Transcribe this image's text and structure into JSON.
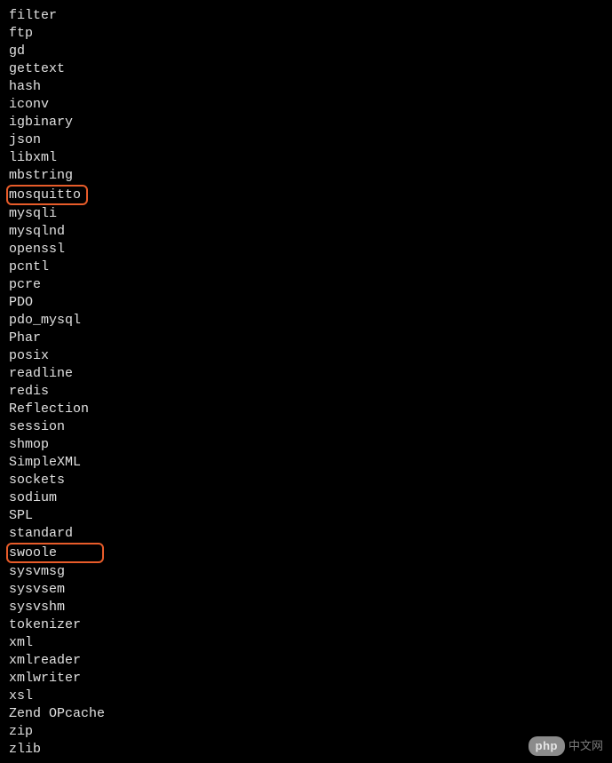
{
  "modules": [
    {
      "name": "filter",
      "highlighted": false
    },
    {
      "name": "ftp",
      "highlighted": false
    },
    {
      "name": "gd",
      "highlighted": false
    },
    {
      "name": "gettext",
      "highlighted": false
    },
    {
      "name": "hash",
      "highlighted": false
    },
    {
      "name": "iconv",
      "highlighted": false
    },
    {
      "name": "igbinary",
      "highlighted": false
    },
    {
      "name": "json",
      "highlighted": false
    },
    {
      "name": "libxml",
      "highlighted": false
    },
    {
      "name": "mbstring",
      "highlighted": false
    },
    {
      "name": "mosquitto",
      "highlighted": true
    },
    {
      "name": "mysqli",
      "highlighted": false
    },
    {
      "name": "mysqlnd",
      "highlighted": false
    },
    {
      "name": "openssl",
      "highlighted": false
    },
    {
      "name": "pcntl",
      "highlighted": false
    },
    {
      "name": "pcre",
      "highlighted": false
    },
    {
      "name": "PDO",
      "highlighted": false
    },
    {
      "name": "pdo_mysql",
      "highlighted": false
    },
    {
      "name": "Phar",
      "highlighted": false
    },
    {
      "name": "posix",
      "highlighted": false
    },
    {
      "name": "readline",
      "highlighted": false
    },
    {
      "name": "redis",
      "highlighted": false
    },
    {
      "name": "Reflection",
      "highlighted": false
    },
    {
      "name": "session",
      "highlighted": false
    },
    {
      "name": "shmop",
      "highlighted": false
    },
    {
      "name": "SimpleXML",
      "highlighted": false
    },
    {
      "name": "sockets",
      "highlighted": false
    },
    {
      "name": "sodium",
      "highlighted": false
    },
    {
      "name": "SPL",
      "highlighted": false
    },
    {
      "name": "standard",
      "highlighted": false
    },
    {
      "name": "swoole",
      "highlighted": true
    },
    {
      "name": "sysvmsg",
      "highlighted": false
    },
    {
      "name": "sysvsem",
      "highlighted": false
    },
    {
      "name": "sysvshm",
      "highlighted": false
    },
    {
      "name": "tokenizer",
      "highlighted": false
    },
    {
      "name": "xml",
      "highlighted": false
    },
    {
      "name": "xmlreader",
      "highlighted": false
    },
    {
      "name": "xmlwriter",
      "highlighted": false
    },
    {
      "name": "xsl",
      "highlighted": false
    },
    {
      "name": "Zend OPcache",
      "highlighted": false
    },
    {
      "name": "zip",
      "highlighted": false
    },
    {
      "name": "zlib",
      "highlighted": false
    }
  ],
  "highlight_width": {
    "mosquitto": "92px",
    "swoole": "110px"
  },
  "watermark": {
    "pill": "php",
    "text": "中文网"
  }
}
